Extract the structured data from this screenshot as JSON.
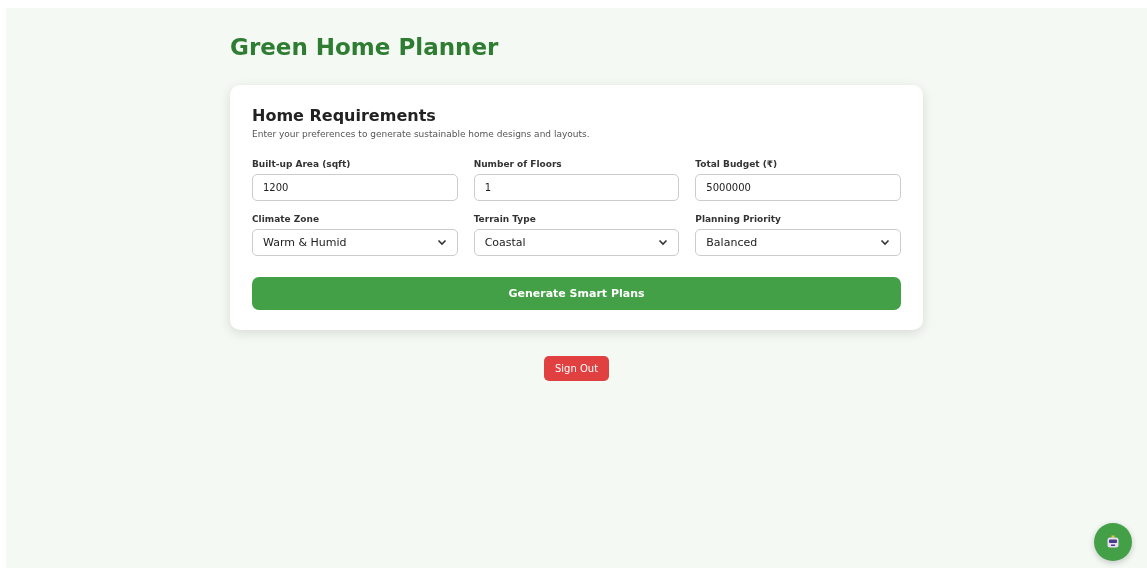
{
  "title": "Green Home Planner",
  "form": {
    "heading": "Home Requirements",
    "description": "Enter your preferences to generate sustainable home designs and layouts.",
    "fields": [
      {
        "label": "Built-up Area (sqft)",
        "kind": "input",
        "value": "1200"
      },
      {
        "label": "Number of Floors",
        "kind": "input",
        "value": "1"
      },
      {
        "label": "Total Budget (₹)",
        "kind": "input",
        "value": "5000000"
      },
      {
        "label": "Climate Zone",
        "kind": "select",
        "value": "Warm & Humid"
      },
      {
        "label": "Terrain Type",
        "kind": "select",
        "value": "Coastal"
      },
      {
        "label": "Planning Priority",
        "kind": "select",
        "value": "Balanced"
      }
    ],
    "submit": "Generate Smart Plans"
  },
  "sign_out": "Sign Out"
}
